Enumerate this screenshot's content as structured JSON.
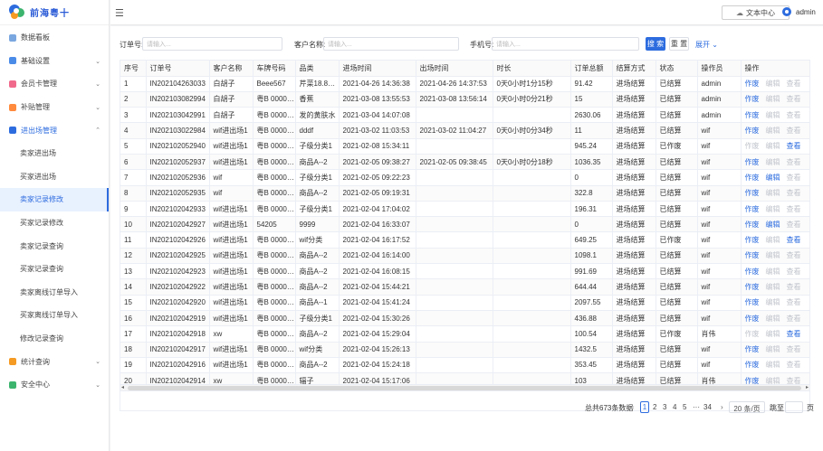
{
  "brand": {
    "name": "前海粤十"
  },
  "header": {
    "text_mode": "文本中心",
    "user": "admin"
  },
  "sidebar": {
    "items": [
      {
        "label": "数据看板",
        "color": "#7aa7e0"
      },
      {
        "label": "基础设置",
        "color": "#4b8be8",
        "chev": "⌄"
      },
      {
        "label": "会员卡管理",
        "color": "#f06a8c",
        "chev": "⌄"
      },
      {
        "label": "补贴管理",
        "color": "#ff8a3d",
        "chev": "⌄"
      },
      {
        "label": "进出场管理",
        "color": "#2d6cdf",
        "chev": "⌃"
      }
    ],
    "subitems": [
      "卖家进出场",
      "买家进出场",
      "卖家记录修改",
      "买家记录修改",
      "卖家记录查询",
      "买家记录查询",
      "卖家离线订单导入",
      "买家离线订单导入",
      "修改记录查询"
    ],
    "bottom": [
      {
        "label": "统计查询",
        "color": "#f59a23",
        "chev": "⌄"
      },
      {
        "label": "安全中心",
        "color": "#3cb46e",
        "chev": "⌄"
      }
    ]
  },
  "filters": {
    "order_label": "订单号:",
    "order_ph": "请输入...",
    "customer_label": "客户名称:",
    "customer_ph": "请输入...",
    "phone_label": "手机号:",
    "phone_ph": "请输入...",
    "search": "搜 索",
    "reset": "重 置",
    "expand": "展开 ⌄"
  },
  "table": {
    "headers": [
      "序号",
      "订单号",
      "客户名称",
      "车牌号码",
      "品类",
      "进场时间",
      "出场时间",
      "时长",
      "订单总额",
      "结算方式",
      "状态",
      "操作员",
      "操作"
    ],
    "rows": [
      [
        "1",
        "IN202104263033",
        "白胡子",
        "Beee567",
        "芹菜18.8每...",
        "2021-04-26 14:36:38",
        "2021-04-26 14:37:53",
        "0天0小时1分15秒",
        "91.42",
        "进场结算",
        "已结算",
        "admin"
      ],
      [
        "2",
        "IN202103082994",
        "白胡子",
        "粤B 000001",
        "香蕉",
        "2021-03-08 13:55:53",
        "2021-03-08 13:56:14",
        "0天0小时0分21秒",
        "15",
        "进场结算",
        "已结算",
        "admin"
      ],
      [
        "3",
        "IN202103042991",
        "白胡子",
        "粤B 000001",
        "发的黄肤水",
        "2021-03-04 14:07:08",
        "",
        "",
        "2630.06",
        "进场结算",
        "已结算",
        "admin"
      ],
      [
        "4",
        "IN202103022984",
        "wif进出场1",
        "粤B 000001",
        "dddf",
        "2021-03-02 11:03:53",
        "2021-03-02 11:04:27",
        "0天0小时0分34秒",
        "11",
        "进场结算",
        "已结算",
        "wif"
      ],
      [
        "5",
        "IN202102052940",
        "wif进出场1",
        "粤B 000001",
        "子级分类1",
        "2021-02-08 15:34:11",
        "",
        "",
        "945.24",
        "进场结算",
        "已作废",
        "wif"
      ],
      [
        "6",
        "IN202102052937",
        "wif进出场1",
        "粤B 000001",
        "商品A--2",
        "2021-02-05 09:38:27",
        "2021-02-05 09:38:45",
        "0天0小时0分18秒",
        "1036.35",
        "进场结算",
        "已结算",
        "wif"
      ],
      [
        "7",
        "IN202102052936",
        "wif",
        "粤B 000001",
        "子级分类1",
        "2021-02-05 09:22:23",
        "",
        "",
        "0",
        "进场结算",
        "已结算",
        "wif"
      ],
      [
        "8",
        "IN202102052935",
        "wif",
        "粤B 000001",
        "商品A--2",
        "2021-02-05 09:19:31",
        "",
        "",
        "322.8",
        "进场结算",
        "已结算",
        "wif"
      ],
      [
        "9",
        "IN202102042933",
        "wif进出场1",
        "粤B 000001",
        "子级分类1",
        "2021-02-04 17:04:02",
        "",
        "",
        "196.31",
        "进场结算",
        "已结算",
        "wif"
      ],
      [
        "10",
        "IN202102042927",
        "wif进出场1",
        "54205",
        "9999",
        "2021-02-04 16:33:07",
        "",
        "",
        "0",
        "进场结算",
        "已结算",
        "wif"
      ],
      [
        "11",
        "IN202102042926",
        "wif进出场1",
        "粤B 000001",
        "wif分类",
        "2021-02-04 16:17:52",
        "",
        "",
        "649.25",
        "进场结算",
        "已作废",
        "wif"
      ],
      [
        "12",
        "IN202102042925",
        "wif进出场1",
        "粤B 000001",
        "商品A--2",
        "2021-02-04 16:14:00",
        "",
        "",
        "1098.1",
        "进场结算",
        "已结算",
        "wif"
      ],
      [
        "13",
        "IN202102042923",
        "wif进出场1",
        "粤B 000001",
        "商品A--2",
        "2021-02-04 16:08:15",
        "",
        "",
        "991.69",
        "进场结算",
        "已结算",
        "wif"
      ],
      [
        "14",
        "IN202102042922",
        "wif进出场1",
        "粤B 000001",
        "商品A--2",
        "2021-02-04 15:44:21",
        "",
        "",
        "644.44",
        "进场结算",
        "已结算",
        "wif"
      ],
      [
        "15",
        "IN202102042920",
        "wif进出场1",
        "粤B 000001",
        "商品A--1",
        "2021-02-04 15:41:24",
        "",
        "",
        "2097.55",
        "进场结算",
        "已结算",
        "wif"
      ],
      [
        "16",
        "IN202102042919",
        "wif进出场1",
        "粤B 000001",
        "子级分类1",
        "2021-02-04 15:30:26",
        "",
        "",
        "436.88",
        "进场结算",
        "已结算",
        "wif"
      ],
      [
        "17",
        "IN202102042918",
        "xw",
        "粤B 000001",
        "商品A--2",
        "2021-02-04 15:29:04",
        "",
        "",
        "100.54",
        "进场结算",
        "已作废",
        "肖伟"
      ],
      [
        "18",
        "IN202102042917",
        "wif进出场1",
        "粤B 000001",
        "wif分类",
        "2021-02-04 15:26:13",
        "",
        "",
        "1432.5",
        "进场结算",
        "已结算",
        "wif"
      ],
      [
        "19",
        "IN202102042916",
        "wif进出场1",
        "粤B 000001",
        "商品A--2",
        "2021-02-04 15:24:18",
        "",
        "",
        "353.45",
        "进场结算",
        "已结算",
        "wif"
      ],
      [
        "20",
        "IN202102042914",
        "xw",
        "粤B 000001",
        "辐子",
        "2021-02-04 15:17:06",
        "",
        "",
        "103",
        "进场结算",
        "已结算",
        "肖伟"
      ]
    ],
    "ops_labels": {
      "void": "作废",
      "edit": "编辑",
      "view": "查看"
    },
    "ops_state": [
      [
        1,
        0,
        0
      ],
      [
        1,
        0,
        0
      ],
      [
        1,
        0,
        0
      ],
      [
        1,
        0,
        0
      ],
      [
        0,
        0,
        1
      ],
      [
        1,
        0,
        0
      ],
      [
        1,
        1,
        0
      ],
      [
        1,
        0,
        0
      ],
      [
        1,
        0,
        0
      ],
      [
        1,
        1,
        0
      ],
      [
        1,
        0,
        1
      ],
      [
        1,
        0,
        0
      ],
      [
        1,
        0,
        0
      ],
      [
        1,
        0,
        0
      ],
      [
        1,
        0,
        0
      ],
      [
        1,
        0,
        0
      ],
      [
        0,
        0,
        1
      ],
      [
        1,
        0,
        0
      ],
      [
        1,
        0,
        0
      ],
      [
        1,
        0,
        0
      ]
    ]
  },
  "pager": {
    "total": "总共673条数据",
    "prev": "‹",
    "pages": [
      "1",
      "2",
      "3",
      "4",
      "5",
      "···",
      "34"
    ],
    "next": "›",
    "size": "20 条/页",
    "goto": "跳至",
    "unit": "页"
  }
}
